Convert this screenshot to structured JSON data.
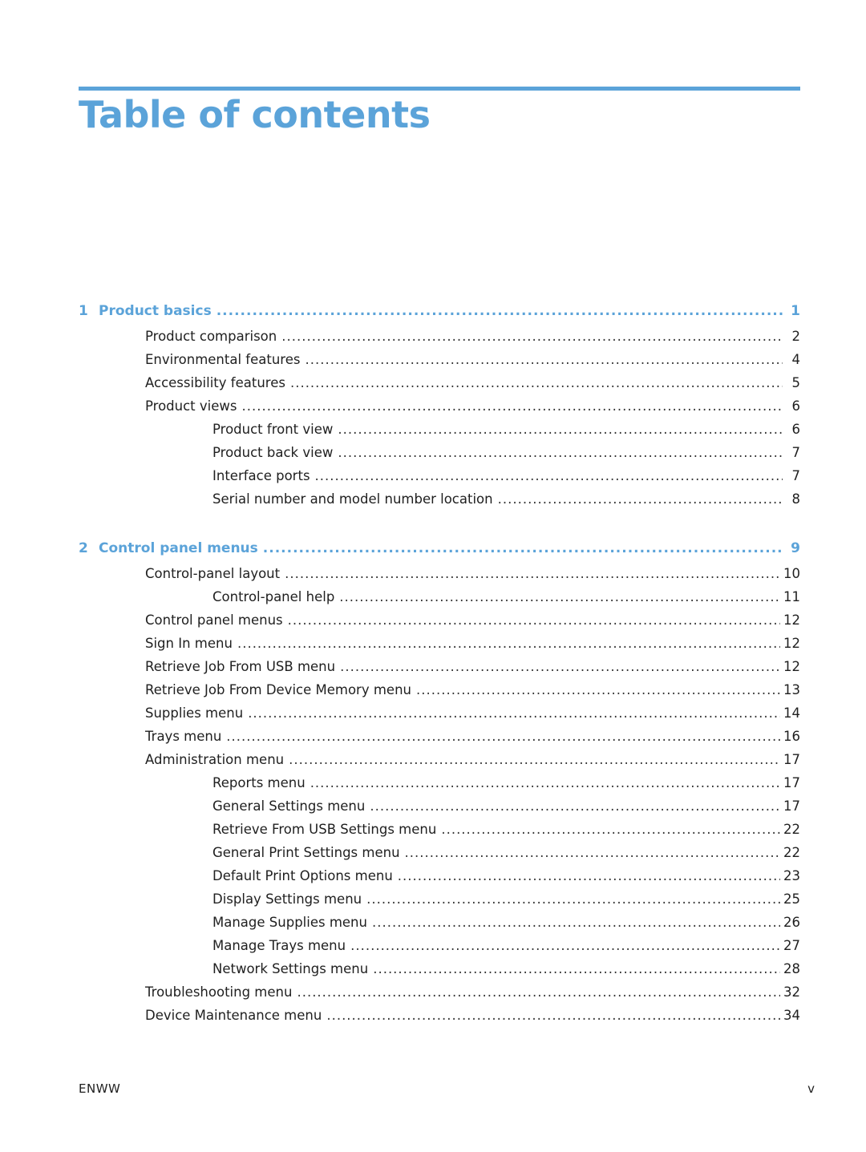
{
  "page": {
    "title": "Table of contents",
    "accent_color": "#5ba3d9",
    "footer": {
      "left": "ENWW",
      "right": "v"
    }
  },
  "toc": {
    "chapters": [
      {
        "number": "1",
        "title": "Product basics",
        "page": "1",
        "entries": [
          {
            "level": 1,
            "title": "Product comparison",
            "page": "2"
          },
          {
            "level": 1,
            "title": "Environmental features",
            "page": "4"
          },
          {
            "level": 1,
            "title": "Accessibility features",
            "page": "5"
          },
          {
            "level": 1,
            "title": "Product views",
            "page": "6"
          },
          {
            "level": 2,
            "title": "Product front view",
            "page": "6"
          },
          {
            "level": 2,
            "title": "Product back view",
            "page": "7"
          },
          {
            "level": 2,
            "title": "Interface ports",
            "page": "7"
          },
          {
            "level": 2,
            "title": "Serial number and model number location",
            "page": "8"
          }
        ]
      },
      {
        "number": "2",
        "title": "Control panel menus",
        "page": "9",
        "entries": [
          {
            "level": 1,
            "title": "Control-panel layout",
            "page": "10"
          },
          {
            "level": 2,
            "title": "Control-panel help",
            "page": "11"
          },
          {
            "level": 1,
            "title": "Control panel menus",
            "page": "12"
          },
          {
            "level": 1,
            "title": "Sign In menu",
            "page": "12"
          },
          {
            "level": 1,
            "title": "Retrieve Job From USB menu",
            "page": "12"
          },
          {
            "level": 1,
            "title": "Retrieve Job From Device Memory menu",
            "page": "13"
          },
          {
            "level": 1,
            "title": "Supplies menu",
            "page": "14"
          },
          {
            "level": 1,
            "title": "Trays menu",
            "page": "16"
          },
          {
            "level": 1,
            "title": "Administration menu",
            "page": "17"
          },
          {
            "level": 2,
            "title": "Reports menu",
            "page": "17"
          },
          {
            "level": 2,
            "title": "General Settings menu",
            "page": "17"
          },
          {
            "level": 2,
            "title": "Retrieve From USB Settings menu",
            "page": "22"
          },
          {
            "level": 2,
            "title": "General Print Settings menu",
            "page": "22"
          },
          {
            "level": 2,
            "title": "Default Print Options menu",
            "page": "23"
          },
          {
            "level": 2,
            "title": "Display Settings menu",
            "page": "25"
          },
          {
            "level": 2,
            "title": "Manage Supplies menu",
            "page": "26"
          },
          {
            "level": 2,
            "title": "Manage Trays menu",
            "page": "27"
          },
          {
            "level": 2,
            "title": "Network Settings menu",
            "page": "28"
          },
          {
            "level": 1,
            "title": "Troubleshooting menu",
            "page": "32"
          },
          {
            "level": 1,
            "title": "Device Maintenance menu",
            "page": "34"
          }
        ]
      }
    ]
  }
}
